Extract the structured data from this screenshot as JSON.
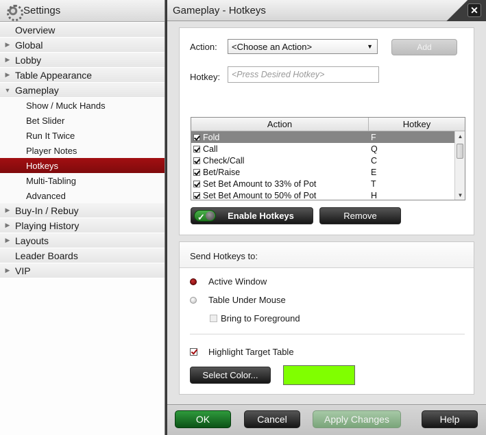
{
  "sidebar": {
    "title": "Settings",
    "items": [
      {
        "label": "Overview",
        "level": "top",
        "arrow": ""
      },
      {
        "label": "Global",
        "level": "top",
        "arrow": "▶"
      },
      {
        "label": "Lobby",
        "level": "top",
        "arrow": "▶"
      },
      {
        "label": "Table Appearance",
        "level": "top",
        "arrow": "▶"
      },
      {
        "label": "Gameplay",
        "level": "top",
        "arrow": "▼"
      },
      {
        "label": "Show / Muck Hands",
        "level": "sub"
      },
      {
        "label": "Bet Slider",
        "level": "sub"
      },
      {
        "label": "Run It Twice",
        "level": "sub"
      },
      {
        "label": "Player Notes",
        "level": "sub"
      },
      {
        "label": "Hotkeys",
        "level": "sub",
        "active": true
      },
      {
        "label": "Multi-Tabling",
        "level": "sub"
      },
      {
        "label": "Advanced",
        "level": "sub"
      },
      {
        "label": "Buy-In / Rebuy",
        "level": "top",
        "arrow": "▶"
      },
      {
        "label": "Playing History",
        "level": "top",
        "arrow": "▶"
      },
      {
        "label": "Layouts",
        "level": "top",
        "arrow": "▶"
      },
      {
        "label": "Leader Boards",
        "level": "top",
        "arrow": ""
      },
      {
        "label": "VIP",
        "level": "top",
        "arrow": "▶"
      }
    ]
  },
  "header": {
    "title": "Gameplay - Hotkeys",
    "close": "✕"
  },
  "hotkeys": {
    "action_label": "Action:",
    "action_selected": "<Choose an Action>",
    "add_label": "Add",
    "hotkey_label": "Hotkey:",
    "hotkey_placeholder": "<Press Desired Hotkey>",
    "table": {
      "col_action": "Action",
      "col_hotkey": "Hotkey",
      "rows": [
        {
          "action": "Fold",
          "hotkey": "F",
          "selected": true
        },
        {
          "action": "Call",
          "hotkey": "Q"
        },
        {
          "action": "Check/Call",
          "hotkey": "C"
        },
        {
          "action": "Bet/Raise",
          "hotkey": "E"
        },
        {
          "action": "Set Bet Amount to 33% of Pot",
          "hotkey": "T"
        },
        {
          "action": "Set Bet Amount to 50% of Pot",
          "hotkey": "H"
        }
      ]
    },
    "enable_label": "Enable Hotkeys",
    "remove_label": "Remove"
  },
  "send": {
    "header": "Send Hotkeys to:",
    "active_window": "Active Window",
    "table_under_mouse": "Table Under Mouse",
    "bring_to_foreground": "Bring to Foreground",
    "highlight_target_table": "Highlight Target Table",
    "select_color_label": "Select Color...",
    "highlight_color": "#80ff00"
  },
  "footer": {
    "ok": "OK",
    "cancel": "Cancel",
    "apply": "Apply Changes",
    "help": "Help"
  }
}
